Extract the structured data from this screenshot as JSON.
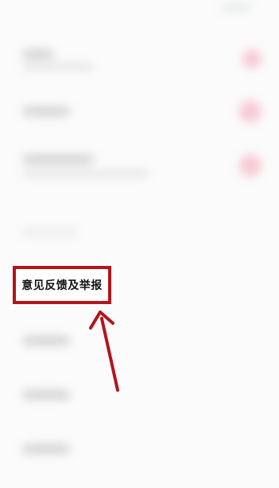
{
  "screen": {
    "highlighted_item": {
      "label": "意见反馈及举报"
    },
    "annotation": {
      "box_color": "#b3141b",
      "arrow_color": "#b3141b"
    },
    "accent_color": "#f6c4cf"
  }
}
